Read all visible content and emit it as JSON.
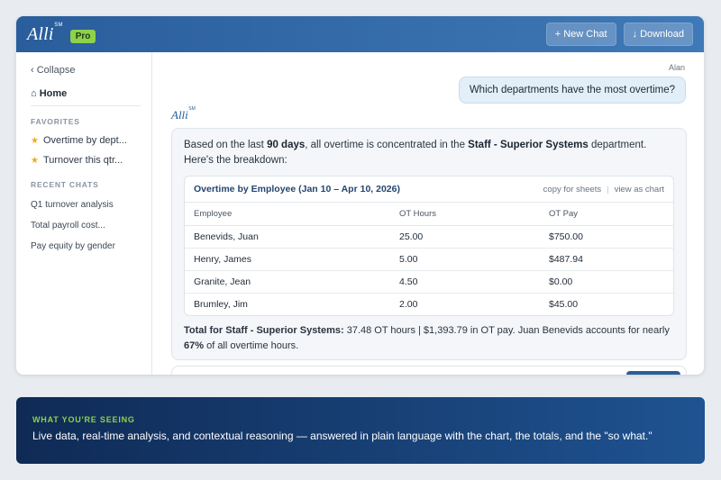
{
  "app": {
    "logo_text": "Alli",
    "logo_mark": "SM",
    "badge": "Pro",
    "brand_color": "#2a5d9b",
    "accent_color": "#8ed14a"
  },
  "toolbar": {
    "new_chat_icon": "plus-icon",
    "new_chat_label": "+ New Chat",
    "download_icon": "download-icon",
    "download_label": "↓ Download"
  },
  "sidebar": {
    "collapse_label": "‹ Collapse",
    "home_label": "⌂ Home",
    "favorites_heading": "FAVORITES",
    "favorites": [
      {
        "label": "Overtime by dept...",
        "icon": "star-icon"
      },
      {
        "label": "Turnover this qtr...",
        "icon": "star-icon"
      }
    ],
    "recent_heading": "RECENT CHATS",
    "recent": [
      {
        "label": "Q1 turnover analysis"
      },
      {
        "label": "Total payroll cost..."
      },
      {
        "label": "Pay equity by gender"
      }
    ]
  },
  "conversation": {
    "user_name": "Alan",
    "user_message": "Which departments have the most overtime?",
    "assistant_name": "Alli",
    "intro_before": "Based on the last ",
    "intro_bold1": "90 days",
    "intro_middle": ", all overtime is concentrated in the ",
    "intro_bold2": "Staff - Superior Systems",
    "intro_after": " department. Here's the breakdown:",
    "table": {
      "title": "Overtime by Employee (Jan 10 – Apr 10, 2026)",
      "copy_label": "copy for sheets",
      "chart_label": "view as chart",
      "separator": "|",
      "columns": [
        "Employee",
        "OT Hours",
        "OT Pay"
      ],
      "rows": [
        {
          "employee": "Benevids, Juan",
          "hours": "25.00",
          "pay": "$750.00"
        },
        {
          "employee": "Henry, James",
          "hours": "5.00",
          "pay": "$487.94"
        },
        {
          "employee": "Granite, Jean",
          "hours": "4.50",
          "pay": "$0.00"
        },
        {
          "employee": "Brumley, Jim",
          "hours": "2.00",
          "pay": "$45.00"
        }
      ]
    },
    "total_bold": "Total for Staff - Superior Systems:",
    "total_text": " 37.48 OT hours | $1,393.79 in OT pay. Juan Benevids accounts for nearly ",
    "total_pct": "67%",
    "total_end": " of all overtime hours."
  },
  "banner": {
    "label": "WHAT YOU'RE SEEING",
    "text": "Live data, real-time analysis, and contextual reasoning — answered in plain language with the chart, the totals, and the \"so what.\""
  }
}
